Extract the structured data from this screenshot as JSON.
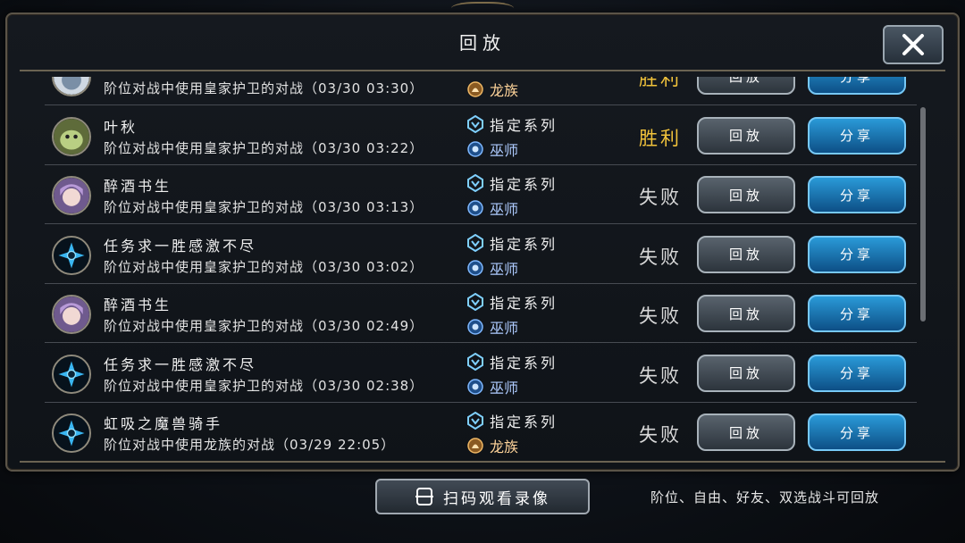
{
  "dialog": {
    "title": "回放",
    "close_icon": "close-icon"
  },
  "replays": [
    {
      "avatar": "dragon-knight",
      "name": "",
      "desc": "阶位对战中使用皇家护卫的对战（03/30 03:30）",
      "tag1": "",
      "tag2": "龙族",
      "tag2_type": "dragon",
      "result": "胜利",
      "win": true,
      "replay": "回放",
      "share": "分享"
    },
    {
      "avatar": "green-creature",
      "name": "叶秋",
      "desc": "阶位对战中使用皇家护卫的对战（03/30 03:22）",
      "tag1": "指定系列",
      "tag2": "巫师",
      "tag2_type": "wizard",
      "result": "胜利",
      "win": true,
      "replay": "回放",
      "share": "分享"
    },
    {
      "avatar": "purple-girl",
      "name": "醉酒书生",
      "desc": "阶位对战中使用皇家护卫的对战（03/30 03:13）",
      "tag1": "指定系列",
      "tag2": "巫师",
      "tag2_type": "wizard",
      "result": "失败",
      "win": false,
      "replay": "回放",
      "share": "分享"
    },
    {
      "avatar": "blue-emblem",
      "name": "任务求一胜感激不尽",
      "desc": "阶位对战中使用皇家护卫的对战（03/30 03:02）",
      "tag1": "指定系列",
      "tag2": "巫师",
      "tag2_type": "wizard",
      "result": "失败",
      "win": false,
      "replay": "回放",
      "share": "分享"
    },
    {
      "avatar": "purple-girl",
      "name": "醉酒书生",
      "desc": "阶位对战中使用皇家护卫的对战（03/30 02:49）",
      "tag1": "指定系列",
      "tag2": "巫师",
      "tag2_type": "wizard",
      "result": "失败",
      "win": false,
      "replay": "回放",
      "share": "分享"
    },
    {
      "avatar": "blue-emblem",
      "name": "任务求一胜感激不尽",
      "desc": "阶位对战中使用皇家护卫的对战（03/30 02:38）",
      "tag1": "指定系列",
      "tag2": "巫师",
      "tag2_type": "wizard",
      "result": "失败",
      "win": false,
      "replay": "回放",
      "share": "分享"
    },
    {
      "avatar": "blue-emblem",
      "name": "虹吸之魔兽骑手",
      "desc": "阶位对战中使用龙族的对战（03/29 22:05）",
      "tag1": "指定系列",
      "tag2": "龙族",
      "tag2_type": "dragon",
      "result": "失败",
      "win": false,
      "replay": "回放",
      "share": "分享"
    }
  ],
  "footer": {
    "scan_label": "扫码观看录像",
    "note": "阶位、自由、好友、双选战斗可回放"
  },
  "colors": {
    "win": "#f2c33b",
    "lose": "#d9d9d9",
    "share_button": "#1a7fc0",
    "replay_button": "#3e4852",
    "frame_gold": "#6b6352"
  }
}
